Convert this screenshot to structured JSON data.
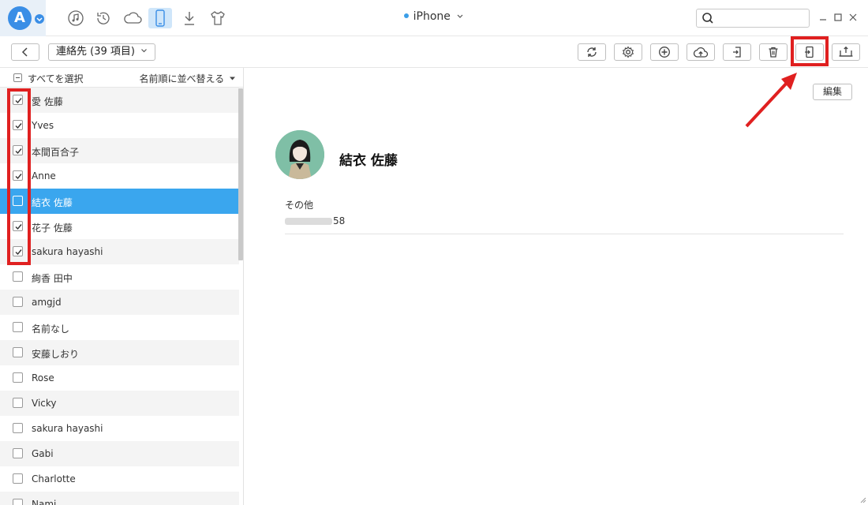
{
  "titlebar": {
    "device_name": "iPhone",
    "search_placeholder": "",
    "nav_icons": [
      "music-icon",
      "history-icon",
      "cloud-icon",
      "phone-icon",
      "download-icon",
      "tshirt-icon"
    ]
  },
  "toolbar": {
    "category_label": "連絡先 (39 項目)",
    "buttons": [
      "refresh-icon",
      "settings-icon",
      "add-icon",
      "upload-cloud-icon",
      "import-icon",
      "trash-icon",
      "export-to-device-icon",
      "export-to-computer-icon"
    ]
  },
  "list": {
    "select_all": "すべてを選択",
    "sort_label": "名前順に並べ替える",
    "contacts": [
      {
        "name": "愛 佐藤",
        "checked": true
      },
      {
        "name": "Yves",
        "checked": true
      },
      {
        "name": "本間百合子",
        "checked": true
      },
      {
        "name": "Anne",
        "checked": true
      },
      {
        "name": "結衣 佐藤",
        "checked": false,
        "selected": true
      },
      {
        "name": "花子 佐藤",
        "checked": true
      },
      {
        "name": "sakura hayashi",
        "checked": true
      },
      {
        "name": "絢香 田中",
        "checked": false
      },
      {
        "name": "amgjd",
        "checked": false
      },
      {
        "name": "名前なし",
        "checked": false
      },
      {
        "name": "安藤しおり",
        "checked": false
      },
      {
        "name": "Rose",
        "checked": false
      },
      {
        "name": "Vicky",
        "checked": false
      },
      {
        "name": "sakura hayashi",
        "checked": false
      },
      {
        "name": "Gabi",
        "checked": false
      },
      {
        "name": "Charlotte",
        "checked": false
      },
      {
        "name": "Nami",
        "checked": false
      }
    ]
  },
  "detail": {
    "edit_label": "編集",
    "contact_name": "結衣 佐藤",
    "field_label": "その他",
    "field_value_suffix": "58"
  },
  "colors": {
    "accent": "#3aa6ee",
    "highlight": "#e02020"
  }
}
